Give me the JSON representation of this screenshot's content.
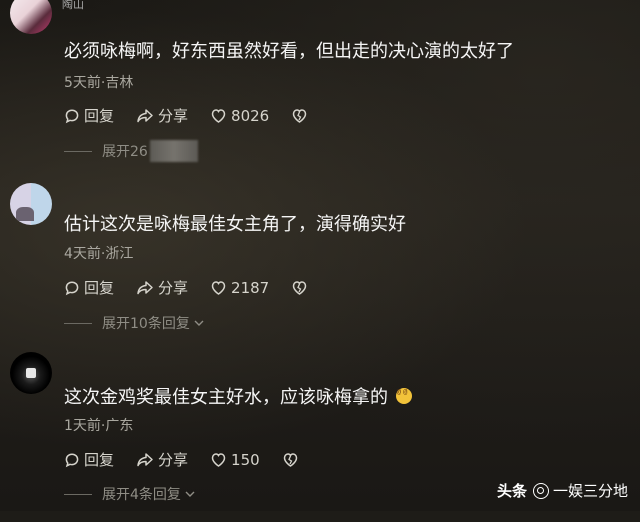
{
  "top_fragment": "陶山",
  "comments": [
    {
      "text": "必须咏梅啊，好东西虽然好看，但出走的决心演的太好了",
      "meta": "5天前·吉林",
      "reply_label": "回复",
      "share_label": "分享",
      "likes": "8026",
      "expand_label": "展开26"
    },
    {
      "text": "估计这次是咏梅最佳女主角了，演得确实好",
      "meta": "4天前·浙江",
      "reply_label": "回复",
      "share_label": "分享",
      "likes": "2187",
      "expand_label": "展开10条回复"
    },
    {
      "text": "这次金鸡奖最佳女主好水，应该咏梅拿的",
      "meta": "1天前·广东",
      "reply_label": "回复",
      "share_label": "分享",
      "likes": "150",
      "expand_label": "展开4条回复"
    }
  ],
  "watermark": {
    "brand": "头条",
    "author": "一娱三分地"
  }
}
